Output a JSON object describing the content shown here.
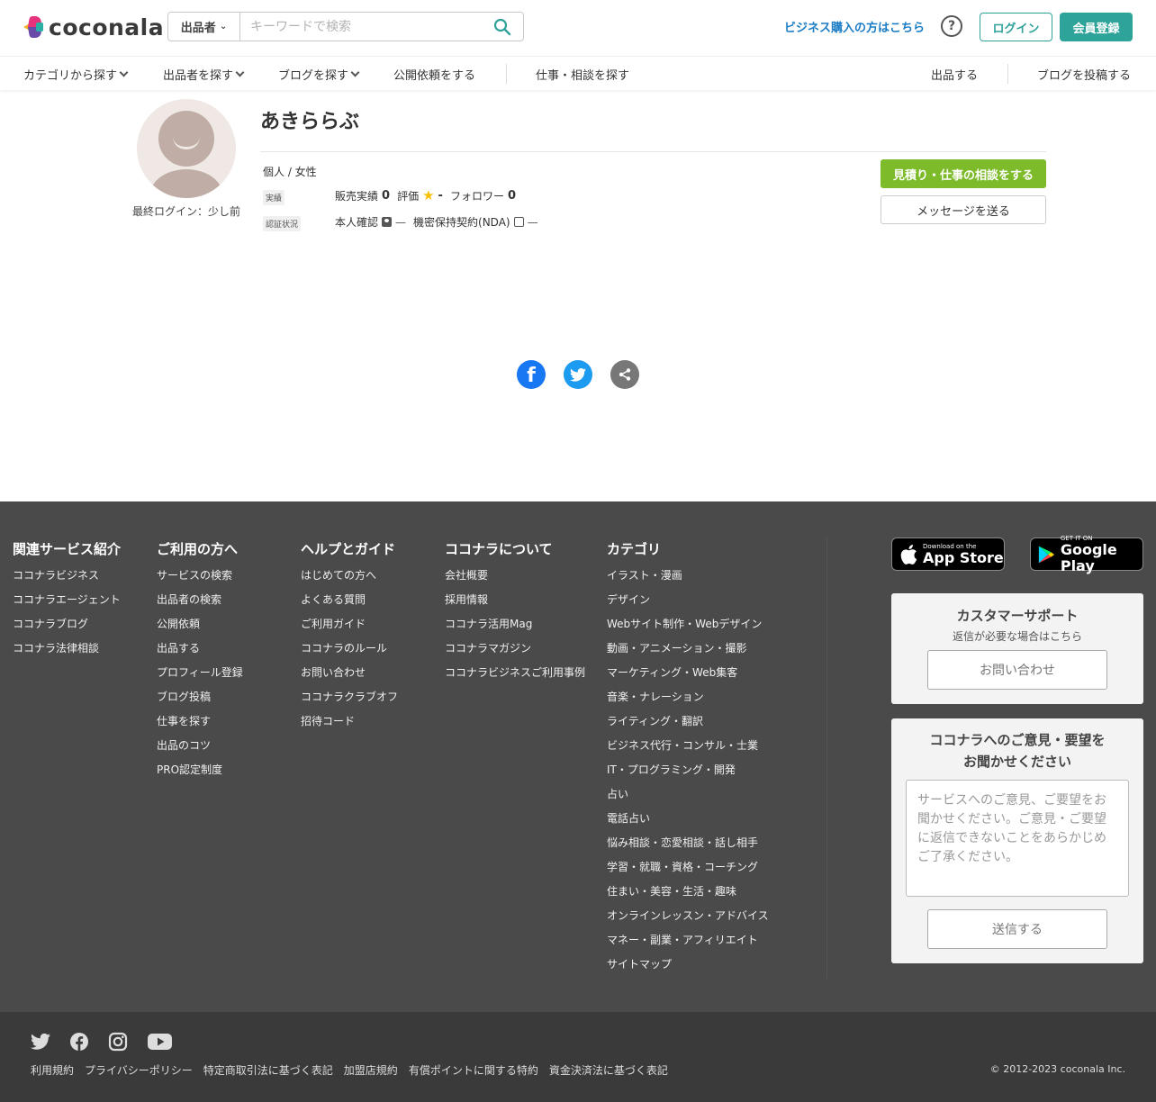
{
  "header": {
    "logo_text": "coconala",
    "search_type": "出品者",
    "search_placeholder": "キーワードで検索",
    "business_link": "ビジネス購入の方はこちら",
    "login": "ログイン",
    "register": "会員登録"
  },
  "nav": {
    "items": [
      "カテゴリから探す",
      "出品者を探す",
      "ブログを探す",
      "公開依頼をする",
      "仕事・相談を探す"
    ],
    "right_items": [
      "出品する",
      "ブログを投稿する"
    ]
  },
  "profile": {
    "last_login": "最終ログイン：少し前",
    "name": "あきららぶ",
    "attributes": "個人 / 女性",
    "tag_results": "実績",
    "sales_label": "販売実績",
    "sales_value": "0",
    "rating_label": "評価",
    "rating_value": "-",
    "followers_label": "フォロワー",
    "followers_value": "0",
    "tag_verify": "認証状況",
    "id_verify_label": "本人確認",
    "id_verify_value": "—",
    "nda_label": "機密保持契約(NDA)",
    "nda_value": "—",
    "consult_button": "見積り・仕事の相談をする",
    "message_button": "メッセージを送る"
  },
  "footer": {
    "columns": [
      {
        "title": "関連サービス紹介",
        "items": [
          "ココナラビジネス",
          "ココナラエージェント",
          "ココナラブログ",
          "ココナラ法律相談"
        ]
      },
      {
        "title": "ご利用の方へ",
        "items": [
          "サービスの検索",
          "出品者の検索",
          "公開依頼",
          "出品する",
          "プロフィール登録",
          "ブログ投稿",
          "仕事を探す",
          "出品のコツ",
          "PRO認定制度"
        ]
      },
      {
        "title": "ヘルプとガイド",
        "items": [
          "はじめての方へ",
          "よくある質問",
          "ご利用ガイド",
          "ココナラのルール",
          "お問い合わせ",
          "ココナラクラブオフ",
          "招待コード"
        ]
      },
      {
        "title": "ココナラについて",
        "items": [
          "会社概要",
          "採用情報",
          "ココナラ活用Mag",
          "ココナラマガジン",
          "ココナラビジネスご利用事例"
        ]
      },
      {
        "title": "カテゴリ",
        "items": [
          "イラスト・漫画",
          "デザイン",
          "Webサイト制作・Webデザイン",
          "動画・アニメーション・撮影",
          "マーケティング・Web集客",
          "音楽・ナレーション",
          "ライティング・翻訳",
          "ビジネス代行・コンサル・士業",
          "IT・プログラミング・開発",
          "占い",
          "電話占い",
          "悩み相談・恋愛相談・話し相手",
          "学習・就職・資格・コーチング",
          "住まい・美容・生活・趣味",
          "オンラインレッスン・アドバイス",
          "マネー・副業・アフィリエイト",
          "サイトマップ"
        ]
      }
    ],
    "appstore_small": "Download on the",
    "appstore_big": "App Store",
    "googleplay_small": "GET IT ON",
    "googleplay_big": "Google Play",
    "support_title": "カスタマーサポート",
    "support_sub": "返信が必要な場合はこちら",
    "support_button": "お問い合わせ",
    "feedback_title": "ココナラへのご意見・要望を\nお聞かせください",
    "feedback_placeholder": "サービスへのご意見、ご要望をお聞かせください。ご意見・ご要望に返信できないことをあらかじめご了承ください。",
    "feedback_button": "送信する",
    "legal": [
      "利用規約",
      "プライバシーポリシー",
      "特定商取引法に基づく表記",
      "加盟店規約",
      "有償ポイントに関する特約",
      "資金決済法に基づく表記"
    ],
    "copyright": "© 2012-2023 coconala Inc."
  },
  "colors": {
    "brand": "#2ea39a",
    "consult": "#7dbb2a",
    "link": "#1a7cc4",
    "footer_bg": "#4a4a4a"
  }
}
